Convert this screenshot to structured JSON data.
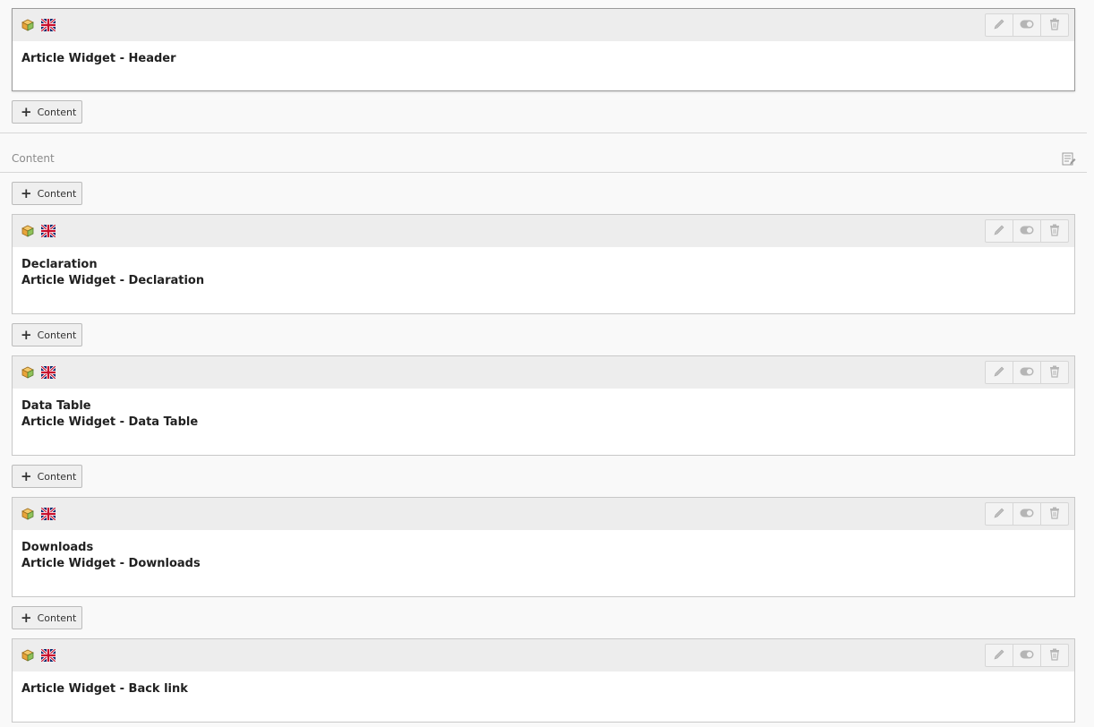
{
  "add_content_label": "Content",
  "section": {
    "title": "Content",
    "edit_icon": "edit-columns-icon"
  },
  "elements": [
    {
      "lines": [
        "Article Widget - Header"
      ]
    },
    {
      "lines": [
        "Declaration",
        "Article Widget - Declaration"
      ]
    },
    {
      "lines": [
        "Data Table",
        "Article Widget - Data Table"
      ]
    },
    {
      "lines": [
        "Downloads",
        "Article Widget - Downloads"
      ]
    },
    {
      "lines": [
        "Article Widget - Back link"
      ]
    }
  ],
  "element_icons": [
    "content-element-icon",
    "uk-flag-icon"
  ],
  "element_actions": [
    "edit-icon",
    "toggle-visibility-icon",
    "delete-icon"
  ],
  "colors": {
    "header_bg": "#ededed",
    "border": "#c8c8c8",
    "page_bg": "#f9f9f9"
  }
}
